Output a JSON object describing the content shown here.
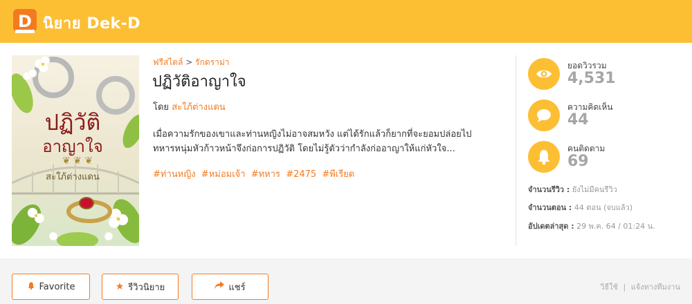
{
  "header": {
    "logo_letter": "D",
    "brand": "นิยาย Dek-D",
    "accent": "#fcbf34"
  },
  "novel": {
    "breadcrumb": {
      "category": "ฟรีสไตล์",
      "separator": ">",
      "genre": "รักดราม่า"
    },
    "title": "ปฏิวัติอาญาใจ",
    "author_prefix": "โดย",
    "author": "สะใภ้ต่างแดน",
    "synopsis_line1": "เมื่อความรักของเขาและท่านหญิงไม่อาจสมหวัง แต่ได้รักแล้วก็ยากที่จะยอมปล่อยไป",
    "synopsis_line2": "ทหารหนุ่มหัวก้าวหน้าจึงก่อการปฏิวัติ โดยไม่รู้ตัวว่ากำลังก่ออาญาให้แก่หัวใจ...",
    "tags": [
      "#ท่านหญิง",
      "#หม่อมเจ้า",
      "#ทหาร",
      "#2475",
      "#พีเรียด"
    ],
    "cover": {
      "title_line1": "ปฏิวัติ",
      "title_line2": "อาญาใจ",
      "author": "สะใภ้ต่างแดน"
    }
  },
  "stats": [
    {
      "icon": "eye-icon",
      "label": "ยอดวิวรวม",
      "value": "4,531"
    },
    {
      "icon": "comment-icon",
      "label": "ความคิดเห็น",
      "value": "44"
    },
    {
      "icon": "bell-icon",
      "label": "คนติดตาม",
      "value": "69"
    }
  ],
  "meta": {
    "reviews_label": "จำนวนรีวิว :",
    "reviews_value": "ยังไม่มีคนรีวิว",
    "episodes_label": "จำนวนตอน :",
    "episodes_value": "44 ตอน (จบแล้ว)",
    "updated_label": "อัปเดตล่าสุด :",
    "updated_value": "29 พ.ค. 64 / 01:24 น."
  },
  "actions": {
    "favorite": "Favorite",
    "review": "รีวิวนิยาย",
    "share": "แชร์"
  },
  "footer_links": {
    "howto": "วิธีใช้",
    "separator": "|",
    "report": "แจ้งทางทีมงาน"
  }
}
